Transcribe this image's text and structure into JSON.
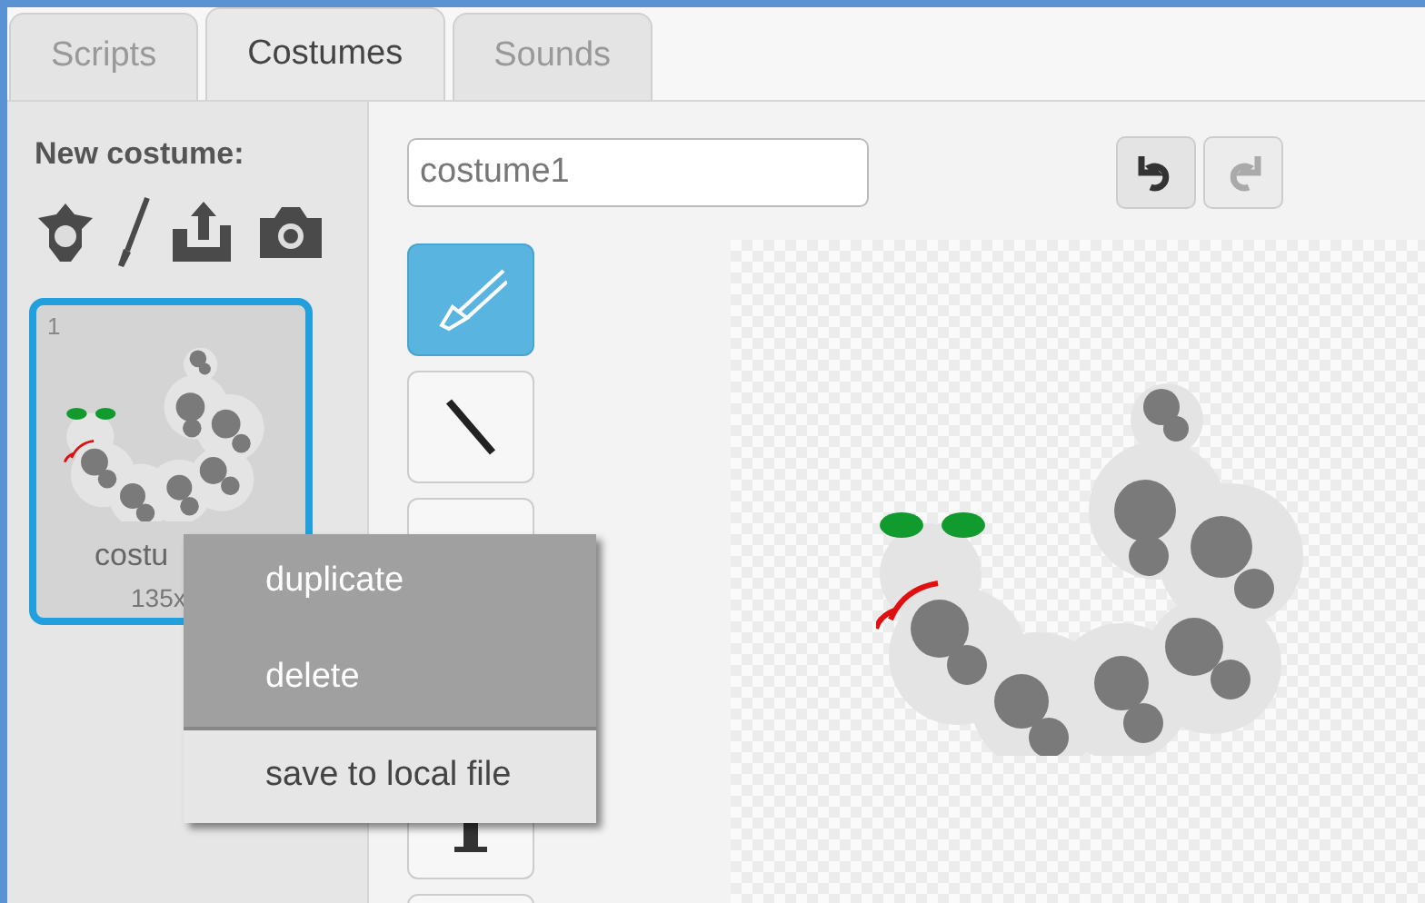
{
  "tabs": [
    {
      "label": "Scripts",
      "selected": false
    },
    {
      "label": "Costumes",
      "selected": true
    },
    {
      "label": "Sounds",
      "selected": false
    }
  ],
  "new_costume": {
    "label": "New costume:"
  },
  "costumes": [
    {
      "number": "1",
      "name": "costu",
      "size": "135x",
      "selected": true
    }
  ],
  "costume_name": {
    "value": "costume1"
  },
  "history": [
    {
      "kind": "undo",
      "disabled": false
    },
    {
      "kind": "redo",
      "disabled": true
    }
  ],
  "tools": [
    {
      "kind": "brush",
      "selected": true
    },
    {
      "kind": "line",
      "selected": false
    },
    {
      "kind": "blank",
      "selected": false
    },
    {
      "kind": "text",
      "selected": false
    },
    {
      "kind": "blank",
      "selected": false
    }
  ],
  "context_menu": [
    {
      "label": "duplicate",
      "highlighted": true
    },
    {
      "label": "delete",
      "highlighted": true
    },
    {
      "label": "save to local file",
      "highlighted": false
    }
  ]
}
